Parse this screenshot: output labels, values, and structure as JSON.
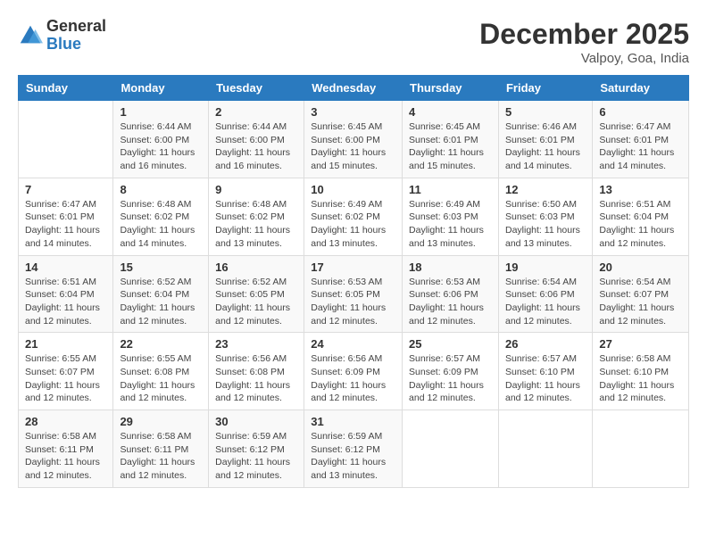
{
  "header": {
    "logo_general": "General",
    "logo_blue": "Blue",
    "month_title": "December 2025",
    "location": "Valpoy, Goa, India"
  },
  "weekdays": [
    "Sunday",
    "Monday",
    "Tuesday",
    "Wednesday",
    "Thursday",
    "Friday",
    "Saturday"
  ],
  "weeks": [
    [
      {
        "day": "",
        "info": ""
      },
      {
        "day": "1",
        "info": "Sunrise: 6:44 AM\nSunset: 6:00 PM\nDaylight: 11 hours and 16 minutes."
      },
      {
        "day": "2",
        "info": "Sunrise: 6:44 AM\nSunset: 6:00 PM\nDaylight: 11 hours and 16 minutes."
      },
      {
        "day": "3",
        "info": "Sunrise: 6:45 AM\nSunset: 6:00 PM\nDaylight: 11 hours and 15 minutes."
      },
      {
        "day": "4",
        "info": "Sunrise: 6:45 AM\nSunset: 6:01 PM\nDaylight: 11 hours and 15 minutes."
      },
      {
        "day": "5",
        "info": "Sunrise: 6:46 AM\nSunset: 6:01 PM\nDaylight: 11 hours and 14 minutes."
      },
      {
        "day": "6",
        "info": "Sunrise: 6:47 AM\nSunset: 6:01 PM\nDaylight: 11 hours and 14 minutes."
      }
    ],
    [
      {
        "day": "7",
        "info": "Sunrise: 6:47 AM\nSunset: 6:01 PM\nDaylight: 11 hours and 14 minutes."
      },
      {
        "day": "8",
        "info": "Sunrise: 6:48 AM\nSunset: 6:02 PM\nDaylight: 11 hours and 14 minutes."
      },
      {
        "day": "9",
        "info": "Sunrise: 6:48 AM\nSunset: 6:02 PM\nDaylight: 11 hours and 13 minutes."
      },
      {
        "day": "10",
        "info": "Sunrise: 6:49 AM\nSunset: 6:02 PM\nDaylight: 11 hours and 13 minutes."
      },
      {
        "day": "11",
        "info": "Sunrise: 6:49 AM\nSunset: 6:03 PM\nDaylight: 11 hours and 13 minutes."
      },
      {
        "day": "12",
        "info": "Sunrise: 6:50 AM\nSunset: 6:03 PM\nDaylight: 11 hours and 13 minutes."
      },
      {
        "day": "13",
        "info": "Sunrise: 6:51 AM\nSunset: 6:04 PM\nDaylight: 11 hours and 12 minutes."
      }
    ],
    [
      {
        "day": "14",
        "info": "Sunrise: 6:51 AM\nSunset: 6:04 PM\nDaylight: 11 hours and 12 minutes."
      },
      {
        "day": "15",
        "info": "Sunrise: 6:52 AM\nSunset: 6:04 PM\nDaylight: 11 hours and 12 minutes."
      },
      {
        "day": "16",
        "info": "Sunrise: 6:52 AM\nSunset: 6:05 PM\nDaylight: 11 hours and 12 minutes."
      },
      {
        "day": "17",
        "info": "Sunrise: 6:53 AM\nSunset: 6:05 PM\nDaylight: 11 hours and 12 minutes."
      },
      {
        "day": "18",
        "info": "Sunrise: 6:53 AM\nSunset: 6:06 PM\nDaylight: 11 hours and 12 minutes."
      },
      {
        "day": "19",
        "info": "Sunrise: 6:54 AM\nSunset: 6:06 PM\nDaylight: 11 hours and 12 minutes."
      },
      {
        "day": "20",
        "info": "Sunrise: 6:54 AM\nSunset: 6:07 PM\nDaylight: 11 hours and 12 minutes."
      }
    ],
    [
      {
        "day": "21",
        "info": "Sunrise: 6:55 AM\nSunset: 6:07 PM\nDaylight: 11 hours and 12 minutes."
      },
      {
        "day": "22",
        "info": "Sunrise: 6:55 AM\nSunset: 6:08 PM\nDaylight: 11 hours and 12 minutes."
      },
      {
        "day": "23",
        "info": "Sunrise: 6:56 AM\nSunset: 6:08 PM\nDaylight: 11 hours and 12 minutes."
      },
      {
        "day": "24",
        "info": "Sunrise: 6:56 AM\nSunset: 6:09 PM\nDaylight: 11 hours and 12 minutes."
      },
      {
        "day": "25",
        "info": "Sunrise: 6:57 AM\nSunset: 6:09 PM\nDaylight: 11 hours and 12 minutes."
      },
      {
        "day": "26",
        "info": "Sunrise: 6:57 AM\nSunset: 6:10 PM\nDaylight: 11 hours and 12 minutes."
      },
      {
        "day": "27",
        "info": "Sunrise: 6:58 AM\nSunset: 6:10 PM\nDaylight: 11 hours and 12 minutes."
      }
    ],
    [
      {
        "day": "28",
        "info": "Sunrise: 6:58 AM\nSunset: 6:11 PM\nDaylight: 11 hours and 12 minutes."
      },
      {
        "day": "29",
        "info": "Sunrise: 6:58 AM\nSunset: 6:11 PM\nDaylight: 11 hours and 12 minutes."
      },
      {
        "day": "30",
        "info": "Sunrise: 6:59 AM\nSunset: 6:12 PM\nDaylight: 11 hours and 12 minutes."
      },
      {
        "day": "31",
        "info": "Sunrise: 6:59 AM\nSunset: 6:12 PM\nDaylight: 11 hours and 13 minutes."
      },
      {
        "day": "",
        "info": ""
      },
      {
        "day": "",
        "info": ""
      },
      {
        "day": "",
        "info": ""
      }
    ]
  ]
}
